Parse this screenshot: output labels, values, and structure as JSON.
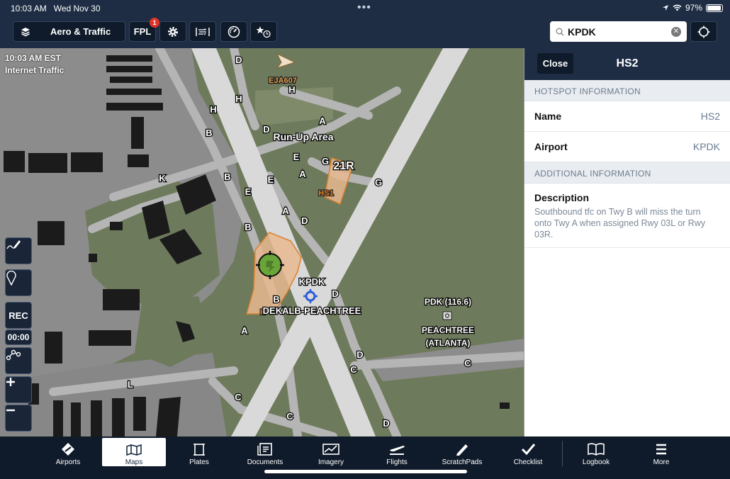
{
  "status": {
    "time": "10:03 AM",
    "date": "Wed Nov 30",
    "battery": "97%"
  },
  "toolbar": {
    "layers_label": "Aero & Traffic",
    "fpl_label": "FPL",
    "fpl_badge": "1",
    "search_value": "KPDK"
  },
  "map": {
    "time": "10:03 AM EST",
    "traffic_source": "Internet Traffic",
    "rec_label": "REC",
    "timer": "00:00",
    "traffic_callsign": "EJA607",
    "runup_area": "Run-Up Area",
    "runway_label": "21R",
    "hotspot_hs1": "HS1",
    "hotspot_partial": "H",
    "airport_code": "KPDK",
    "airport_name": "DEKALB-PEACHTREE",
    "vor_freq": "PDK (116.6)",
    "vor_name1": "PEACHTREE",
    "vor_name2": "(ATLANTA)",
    "taxiways": [
      {
        "l": "D"
      },
      {
        "l": "H"
      },
      {
        "l": "H"
      },
      {
        "l": "H"
      },
      {
        "l": "B"
      },
      {
        "l": "D"
      },
      {
        "l": "A"
      },
      {
        "l": "E"
      },
      {
        "l": "G"
      },
      {
        "l": "A"
      },
      {
        "l": "G"
      },
      {
        "l": "K"
      },
      {
        "l": "B"
      },
      {
        "l": "E"
      },
      {
        "l": "E"
      },
      {
        "l": "A"
      },
      {
        "l": "D"
      },
      {
        "l": "B"
      },
      {
        "l": "B"
      },
      {
        "l": "D"
      },
      {
        "l": "A"
      },
      {
        "l": "D"
      },
      {
        "l": "C"
      },
      {
        "l": "C"
      },
      {
        "l": "L"
      },
      {
        "l": "C"
      },
      {
        "l": "C"
      },
      {
        "l": "D"
      }
    ]
  },
  "panel": {
    "close_label": "Close",
    "title": "HS2",
    "section1": "HOTSPOT INFORMATION",
    "name_label": "Name",
    "name_value": "HS2",
    "airport_label": "Airport",
    "airport_value": "KPDK",
    "section2": "ADDITIONAL INFORMATION",
    "desc_label": "Description",
    "desc_text": "Southbound tfc on Twy B will miss the turn onto Twy A when assigned Rwy 03L or Rwy 03R."
  },
  "tabs": [
    {
      "label": "Airports",
      "icon": "airports-icon"
    },
    {
      "label": "Maps",
      "icon": "maps-icon"
    },
    {
      "label": "Plates",
      "icon": "plates-icon"
    },
    {
      "label": "Documents",
      "icon": "documents-icon"
    },
    {
      "label": "Imagery",
      "icon": "imagery-icon"
    },
    {
      "label": "Flights",
      "icon": "flights-icon"
    },
    {
      "label": "ScratchPads",
      "icon": "scratchpads-icon"
    },
    {
      "label": "Checklist",
      "icon": "checklist-icon"
    },
    {
      "label": "Logbook",
      "icon": "logbook-icon"
    },
    {
      "label": "More",
      "icon": "more-icon"
    }
  ],
  "colors": {
    "toolbar_bg": "#1e2d44",
    "tabbar_bg": "#0f1a2a",
    "map_grass": "#6e7a5c",
    "map_pavement": "#8c8c8c",
    "runway": "#d9d9d9",
    "hotspot_fill": "#e8b98f",
    "hotspot_stroke": "#d9812f",
    "badge": "#e0342a"
  }
}
